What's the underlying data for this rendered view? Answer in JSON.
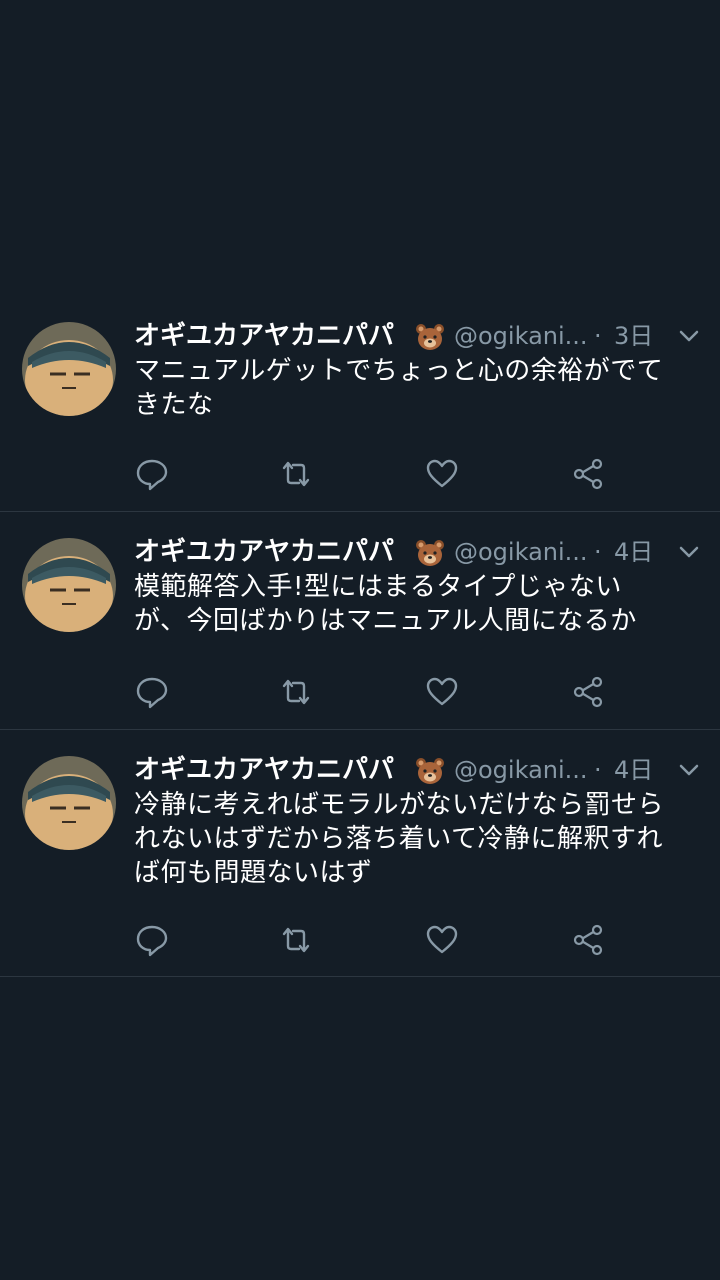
{
  "tweets": [
    {
      "display_name": "オギユカアヤカニパパ",
      "handle": "@ogikani...",
      "separator": "·",
      "time": "3日",
      "text_lines": [
        "マニュアルゲットでちょっと心の余裕がでて",
        "きたな"
      ]
    },
    {
      "display_name": "オギユカアヤカニパパ",
      "handle": "@ogikani...",
      "separator": "·",
      "time": "4日",
      "text_lines": [
        "模範解答入手!型にはまるタイプじゃない",
        "が、今回ばかりはマニュアル人間になるか"
      ]
    },
    {
      "display_name": "オギユカアヤカニパパ",
      "handle": "@ogikani...",
      "separator": "·",
      "time": "4日",
      "text_lines": [
        "冷静に考えればモラルがないだけなら罰せら",
        "れないはずだから落ち着いて冷静に解釈すれ",
        "ば何も問題ないはず"
      ]
    }
  ],
  "icons": {
    "emoji": "bear-face-icon",
    "menu": "chevron-down-icon",
    "reply": "reply-icon",
    "retweet": "retweet-icon",
    "like": "heart-icon",
    "share": "share-icon"
  },
  "colors": {
    "background": "#141d26",
    "text": "#ffffff",
    "secondary": "#8899a6",
    "divider": "#2c3640"
  }
}
